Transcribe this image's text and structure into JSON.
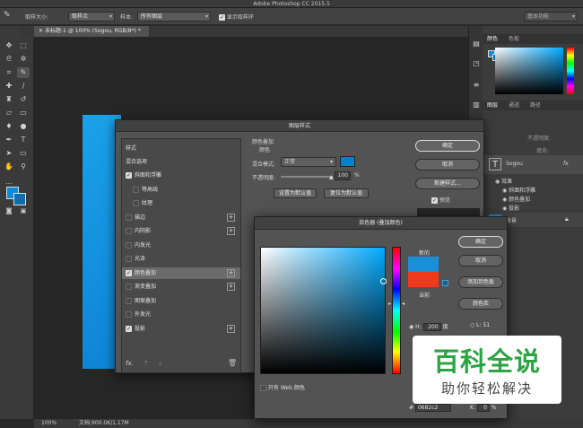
{
  "app": {
    "title": "Adobe Photoshop CC 2015.5"
  },
  "options_bar": {
    "sample_size_label": "取样大小:",
    "sample_size_value": "取样点",
    "sample_label": "样本:",
    "sample_value": "所有图层",
    "show_ring_label": "显示取样环",
    "workspace_value": "基本功能"
  },
  "document": {
    "tab_title": "未标题-1 @ 100% (Sogou, RGB/8*) *"
  },
  "status_bar": {
    "zoom": "100%",
    "doc_size": "文档:900.0K/1.17M"
  },
  "right_panel": {
    "color_tabs": [
      "颜色",
      "色板"
    ],
    "layer_tabs": [
      "图层",
      "通道",
      "路径"
    ],
    "opacity_label": "不透明度:",
    "fill_label": "填充:",
    "layer_name": "Sogou",
    "layer_fx": "fx",
    "effects_label": "效果",
    "effects": [
      "斜面和浮雕",
      "颜色叠加",
      "投影"
    ],
    "background_label": "背景"
  },
  "layer_style_dialog": {
    "title": "图层样式",
    "styles_header": "样式",
    "blend_options": "混合选项",
    "items": [
      {
        "label": "斜面和浮雕",
        "checked": true,
        "plus": false,
        "indent": false,
        "selected": false
      },
      {
        "label": "等高线",
        "checked": false,
        "plus": false,
        "indent": true,
        "selected": false
      },
      {
        "label": "纹理",
        "checked": false,
        "plus": false,
        "indent": true,
        "selected": false
      },
      {
        "label": "描边",
        "checked": false,
        "plus": true,
        "indent": false,
        "selected": false
      },
      {
        "label": "内阴影",
        "checked": false,
        "plus": true,
        "indent": false,
        "selected": false
      },
      {
        "label": "内发光",
        "checked": false,
        "plus": false,
        "indent": false,
        "selected": false
      },
      {
        "label": "光泽",
        "checked": false,
        "plus": false,
        "indent": false,
        "selected": false
      },
      {
        "label": "颜色叠加",
        "checked": true,
        "plus": true,
        "indent": false,
        "selected": true
      },
      {
        "label": "渐变叠加",
        "checked": false,
        "plus": true,
        "indent": false,
        "selected": false
      },
      {
        "label": "图案叠加",
        "checked": false,
        "plus": false,
        "indent": false,
        "selected": false
      },
      {
        "label": "外发光",
        "checked": false,
        "plus": false,
        "indent": false,
        "selected": false
      },
      {
        "label": "投影",
        "checked": true,
        "plus": true,
        "indent": false,
        "selected": false
      }
    ],
    "section_title": "颜色叠加",
    "section_sub": "颜色",
    "blend_mode_label": "混合模式:",
    "blend_mode_value": "正常",
    "opacity_label": "不透明度:",
    "opacity_value": "100",
    "opacity_unit": "%",
    "set_default": "设置为默认值",
    "reset_default": "复位为默认值",
    "ok": "确定",
    "cancel": "取消",
    "new_style": "新建样式...",
    "preview": "预览",
    "fx_label": "fx.",
    "overlay_color": "#0682c2"
  },
  "color_picker": {
    "title": "拾色器 (叠加颜色)",
    "new_label": "新的",
    "current_label": "当前",
    "new_color": "#1a8fd8",
    "current_color": "#ee3a1a",
    "ok": "确定",
    "cancel": "取消",
    "add_swatch": "添加到色板",
    "color_library": "颜色库",
    "h_label": "H:",
    "h_value": "200",
    "h_unit": "度",
    "l_label": "L:",
    "l_value": "51",
    "k_label": "K:",
    "k_value": "0",
    "k_unit": "%",
    "web_only": "只有 Web 颜色",
    "hex_label": "#",
    "hex_value": "0682c2"
  },
  "watermark": {
    "title": "百科全说",
    "subtitle": "助你轻松解决"
  }
}
